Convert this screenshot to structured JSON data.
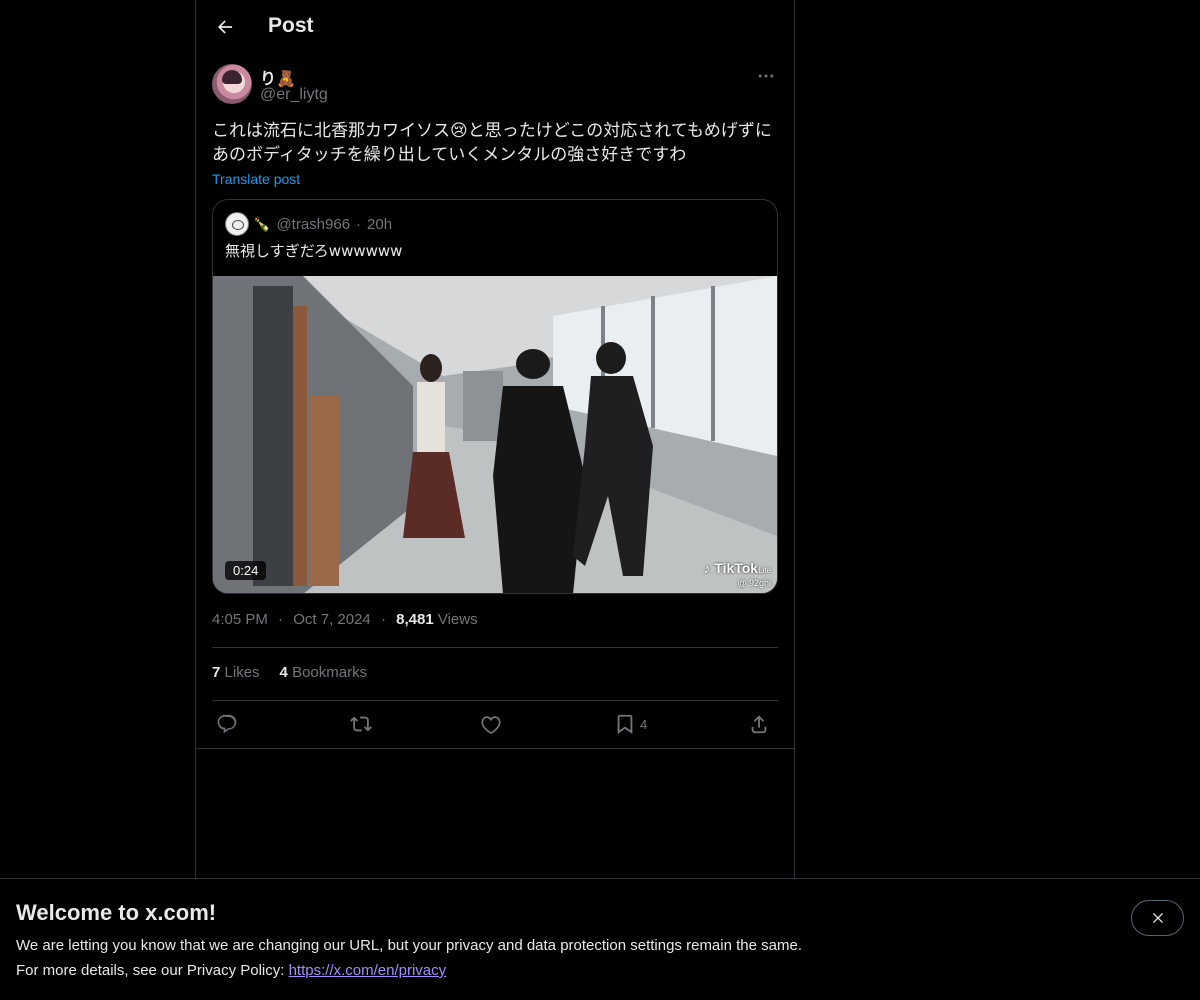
{
  "header": {
    "title": "Post"
  },
  "post": {
    "author_name": "り🧸",
    "author_handle": "@er_liytg",
    "text": "これは流石に北香那カワイソス😢と思ったけどこの対応されてもめげずにあのボディタッチを繰り出していくメンタルの強さ好きですわ",
    "translate_label": "Translate post",
    "more_icon": "more-icon",
    "quote": {
      "name_emoji": "🍾",
      "handle": "@trash966",
      "dot": "·",
      "time": "20h",
      "text": "無視しすぎだろwwwwww",
      "video_duration": "0:24",
      "watermark": "TikTok",
      "watermark_sub": "Lite",
      "watermark_handle": "@ 92ghi"
    },
    "time": "4:05 PM",
    "date": "Oct 7, 2024",
    "meta_sep": "·",
    "views_count": "8,481",
    "views_label": "Views",
    "likes_count": "7",
    "likes_label": "Likes",
    "bookmarks_count": "4",
    "bookmarks_label": "Bookmarks",
    "actions": {
      "reply_icon": "reply-icon",
      "repost_icon": "repost-icon",
      "like_icon": "heart-icon",
      "bookmark_icon": "bookmark-icon",
      "bookmark_count": "4",
      "share_icon": "share-icon"
    }
  },
  "banner": {
    "title": "Welcome to x.com!",
    "line1": "We are letting you know that we are changing our URL, but your privacy and data protection settings remain the same.",
    "line2_prefix": "For more details, see our Privacy Policy: ",
    "link": "https://x.com/en/privacy"
  },
  "colors": {
    "background": "#000000",
    "text": "#e7e9ea",
    "secondary": "#71767b",
    "link": "#1d9bf0",
    "border": "#2f3336",
    "banner_link": "#a78bfa"
  }
}
